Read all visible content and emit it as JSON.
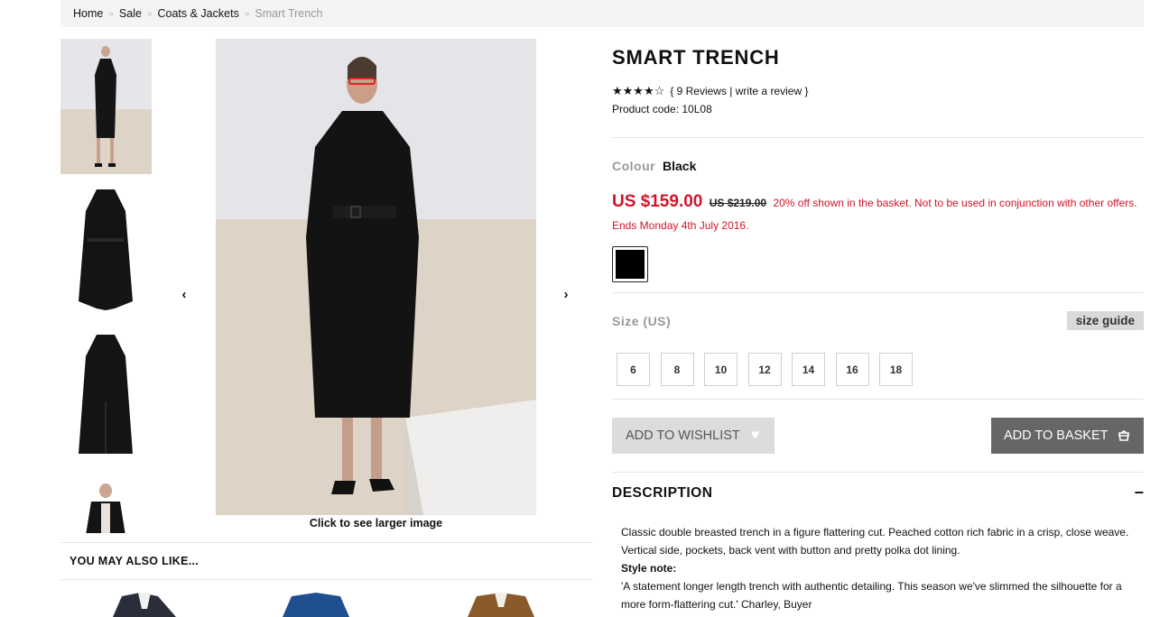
{
  "breadcrumb": [
    "Home",
    "Sale",
    "Coats & Jackets",
    "Smart Trench"
  ],
  "breadcrumb_separator": "»",
  "gallery": {
    "prev_icon": "‹",
    "next_icon": "›",
    "caption": "Click to see larger image"
  },
  "also_like": {
    "title": "YOU MAY ALSO LIKE..."
  },
  "product": {
    "title": "SMART TRENCH",
    "rating": 4,
    "rating_max": 5,
    "stars": "★★★★☆",
    "reviews_text": "{ 9 Reviews | write a review }",
    "product_code": "Product code: 10L08",
    "colour_label": "Colour",
    "colour_value": "Black",
    "price": "US $159.00",
    "old_price": "US $219.00",
    "promo": "20% off shown in the basket. Not to be used in conjunction with other offers. Ends Monday 4th July 2016.",
    "swatch_color": "#000000",
    "size_label": "Size (US)",
    "size_guide": "size guide",
    "sizes": [
      "6",
      "8",
      "10",
      "12",
      "14",
      "16",
      "18"
    ],
    "wishlist_label": "ADD TO WISHLIST",
    "wishlist_icon": "♥",
    "basket_label": "ADD TO BASKET",
    "description_label": "DESCRIPTION",
    "description_toggle": "−",
    "description": "Classic double breasted trench in a figure flattering cut. Peached cotton rich fabric in a crisp, close weave. Vertical side, pockets, back vent with button and pretty polka dot lining.",
    "style_note_label": "Style note:",
    "style_note": "'A statement longer length trench with authentic detailing. This season we've slimmed the silhouette for a more form-flattering cut.' Charley, Buyer"
  },
  "colors": {
    "accent_red": "#d0152a",
    "basket_button": "#666666",
    "wishlist_button": "#dcdcdc"
  }
}
